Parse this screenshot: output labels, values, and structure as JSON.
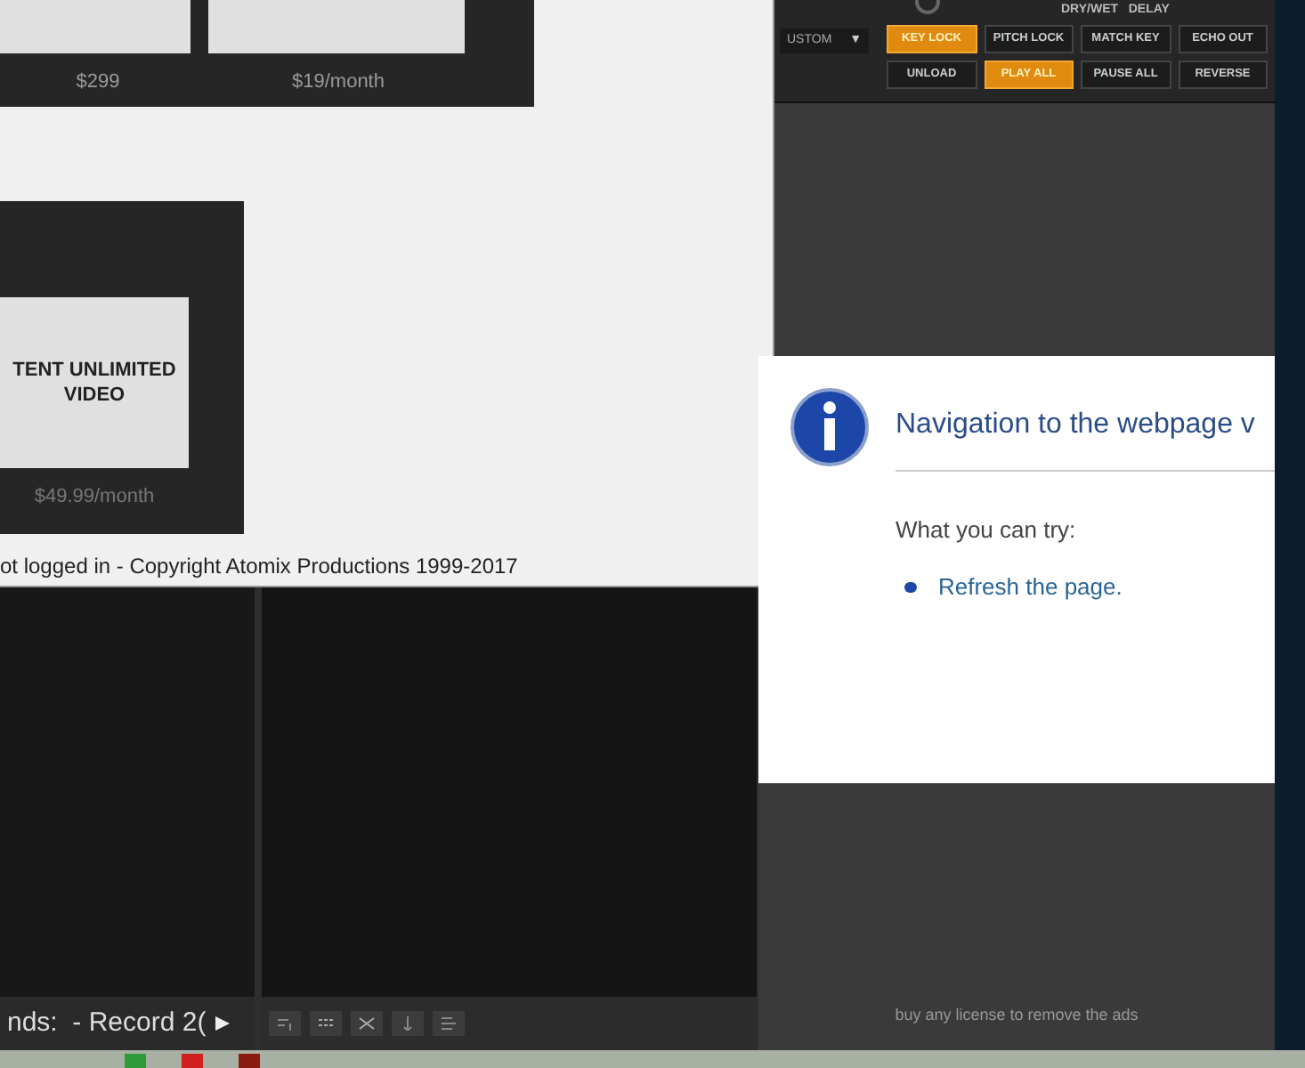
{
  "deck": {
    "label": "DRY/WET   DELAY",
    "dropdown": "USTOM",
    "dropdown_arrow": "▼",
    "buttons": [
      {
        "label": "KEY LOCK",
        "on": true
      },
      {
        "label": "PITCH LOCK",
        "on": false
      },
      {
        "label": "MATCH KEY",
        "on": false
      },
      {
        "label": "ECHO OUT",
        "on": false
      },
      {
        "label": "UNLOAD",
        "on": false
      },
      {
        "label": "PLAY ALL",
        "on": true
      },
      {
        "label": "PAUSE ALL",
        "on": false
      },
      {
        "label": "REVERSE",
        "on": false
      }
    ]
  },
  "store": {
    "top_products": [
      {
        "price": "$299"
      },
      {
        "price": "$19/month"
      }
    ],
    "product": {
      "name": "TENT UNLIMITED VIDEO",
      "price": "$49.99/month"
    },
    "footer": "ot logged in - Copyright Atomix Productions 1999-2017"
  },
  "playlist": {
    "status": "nds:  - Record 2("
  },
  "error_page": {
    "title": "Navigation to the webpage v",
    "subheading": "What you can try:",
    "suggestions": [
      "Refresh the page."
    ]
  },
  "ad_notice": "buy any license to remove the ads"
}
